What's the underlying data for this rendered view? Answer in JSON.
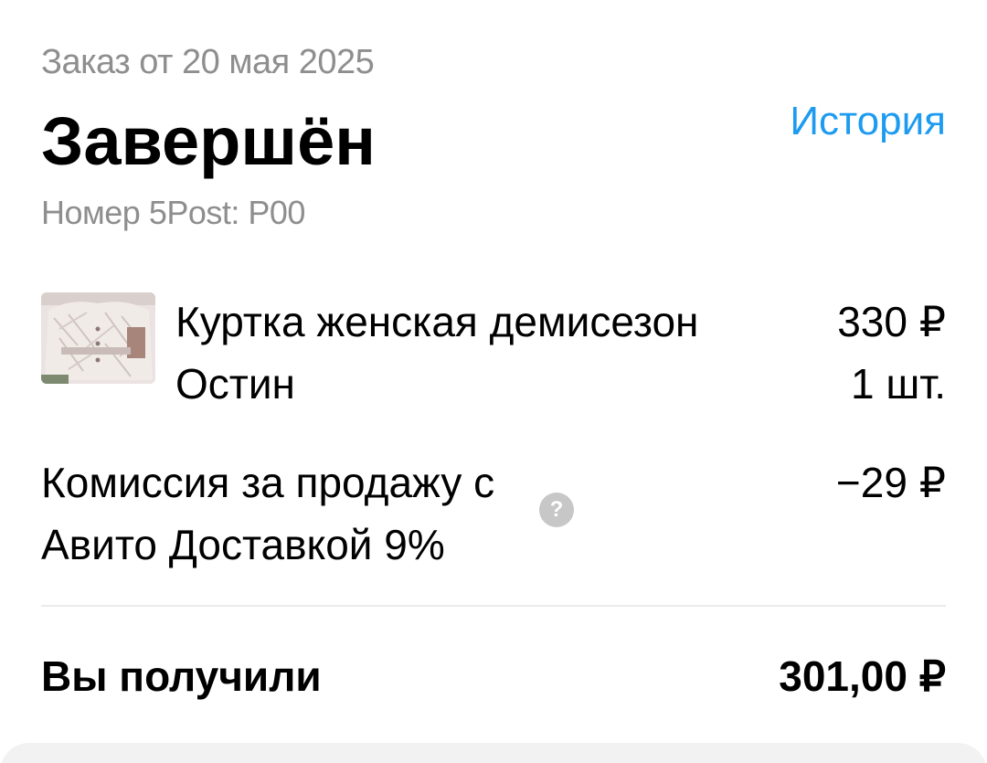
{
  "header": {
    "order_date": "Заказ от 20 мая 2025",
    "status": "Завершён",
    "history_link": "История",
    "tracking": "Номер 5Post: P00"
  },
  "item": {
    "name": "Куртка женская демисезон Остин",
    "price": "330 ₽",
    "quantity": "1 шт.",
    "thumbnail": "jacket-photo"
  },
  "fee": {
    "label": "Комиссия за продажу с Авито Доставкой 9%",
    "amount": "−29 ₽",
    "help_icon": "question-icon"
  },
  "total": {
    "label": "Вы получили",
    "amount": "301,00 ₽"
  },
  "colors": {
    "link": "#1d9bf0",
    "muted_text": "#8e8e8e",
    "help_icon_bg": "#c7c7c7",
    "divider": "#ebebeb"
  }
}
